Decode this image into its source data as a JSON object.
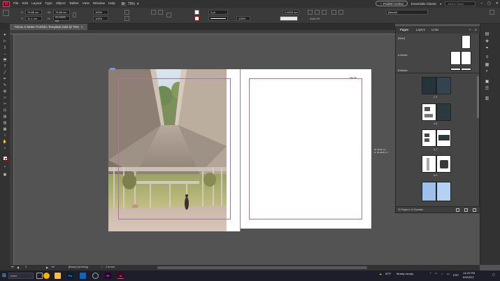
{
  "menu": {
    "app_logo": "Id",
    "items": [
      "File",
      "Edit",
      "Layout",
      "Type",
      "Object",
      "Tables",
      "View",
      "Window",
      "Help"
    ],
    "bridge": "Br",
    "zoom": "75%",
    "publish_online": "Publish Online",
    "workspace": "Essentials Classic",
    "stock_placeholder": "Adobe Stock"
  },
  "control": {
    "x": "76.88 cm",
    "y": "11.1 cm",
    "w": "76.88 cm",
    "h": "22.0229 cm",
    "scale_x": "100%",
    "scale_y": "100%",
    "stroke": "0 pt",
    "measure": "0.4233 cm",
    "pct": "100%",
    "autofit": "Auto-Fit",
    "style": "[None]+"
  },
  "document": {
    "tab_label": "*Show X better Portfolio Template.indd @ 75%",
    "close": "×",
    "page_header": "Page title",
    "measure_w": "W: 35.56 cm",
    "measure_h": "H: 22.0229 cm"
  },
  "pages_panel": {
    "tabs": [
      "Pages",
      "Layers",
      "Links"
    ],
    "masters": [
      "[None]",
      "A-Master",
      "B-Master"
    ],
    "spread_labels": [
      "2–3",
      "4–5",
      "6–7",
      "8–9"
    ],
    "footer": "20 Pages in 11 Spreads"
  },
  "status": {
    "page_num": "1",
    "prefix": "[Basic] (working)",
    "errors": "2 errors"
  },
  "taskbar": {
    "search": "better",
    "weather_temp": "52°F",
    "weather_text": "Mostly cloudy",
    "time": "14:20 PM",
    "date": "6/9/2022",
    "lang": "ESP"
  },
  "colors": {
    "accent": "#ff3366",
    "guide": "#b46bb0"
  }
}
